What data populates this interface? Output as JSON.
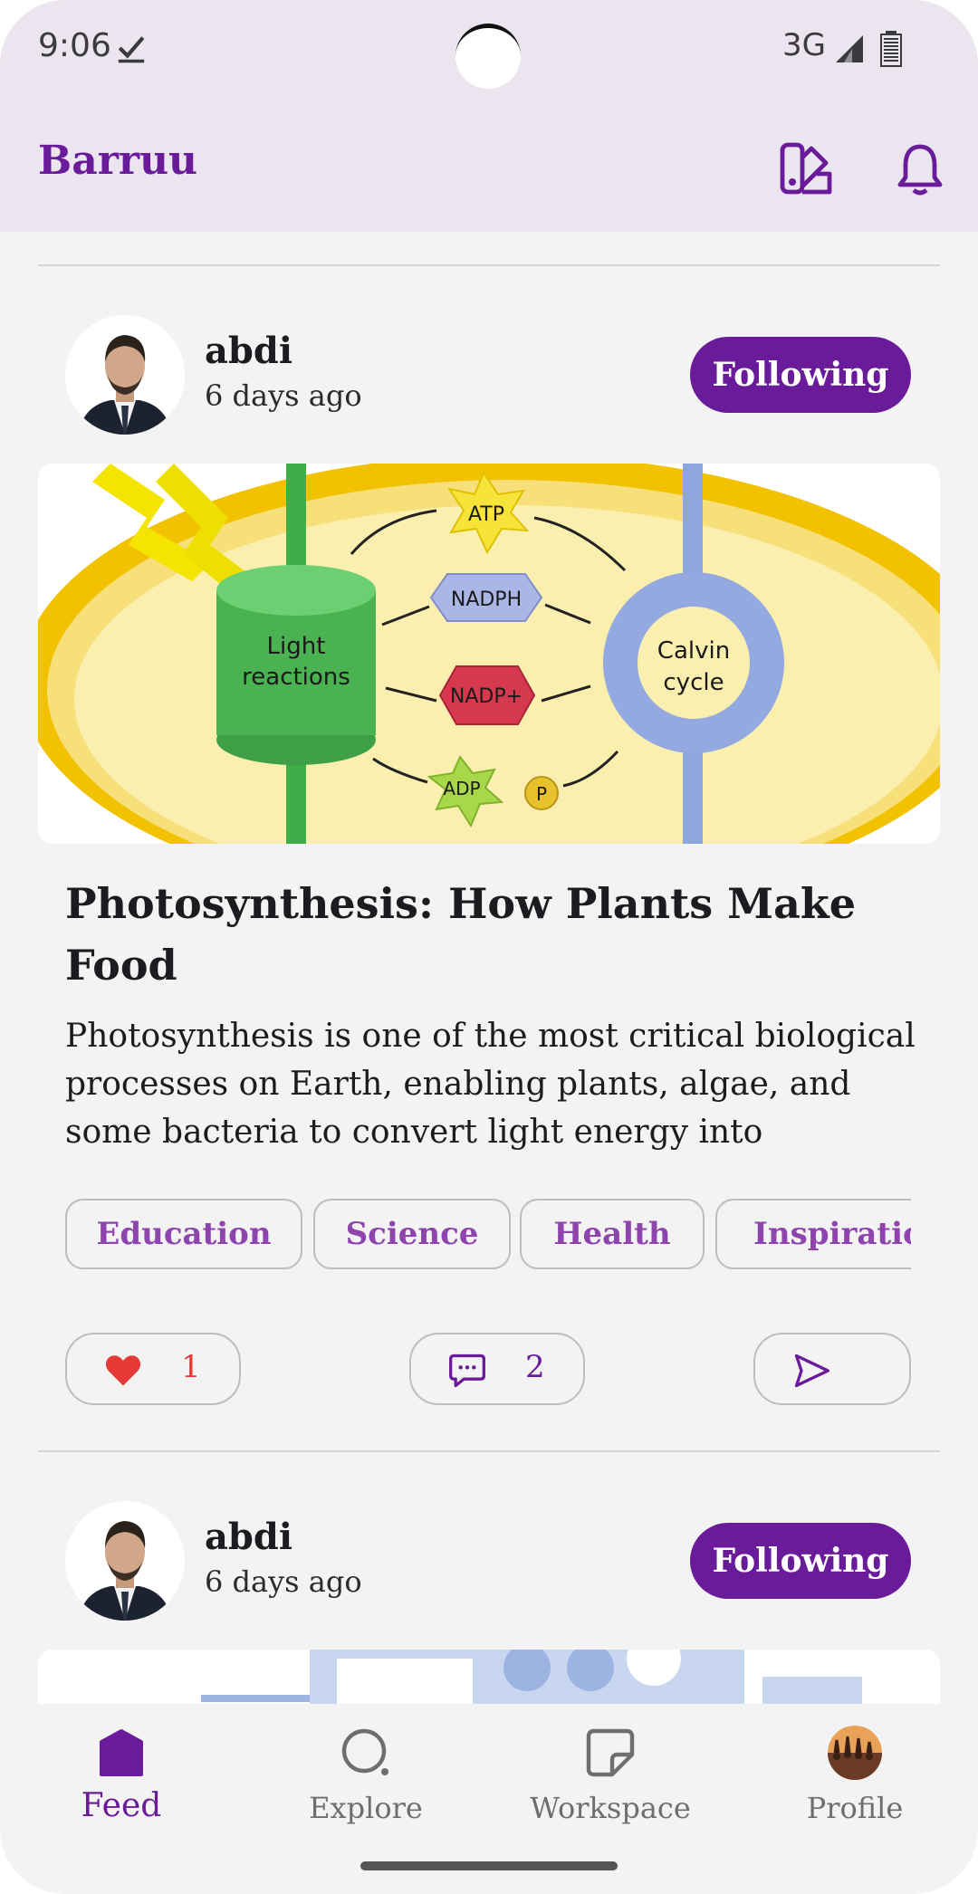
{
  "status_bar": {
    "time": "9:06",
    "network": "3G"
  },
  "app_bar": {
    "title": "Barruu"
  },
  "posts": [
    {
      "author": "abdi",
      "time": "6 days ago",
      "follow_label": "Following",
      "image_labels": {
        "atp": "ATP",
        "nadph": "NADPH",
        "nadp": "NADP+",
        "adp": "ADP",
        "p": "P",
        "light1": "Light",
        "light2": "reactions",
        "calvin1": "Calvin",
        "calvin2": "cycle"
      },
      "title": "Photosynthesis: How Plants Make Food",
      "excerpt": "Photosynthesis is one of the most critical biological processes on Earth, enabling plants, algae, and some bacteria to convert light energy into chemic…",
      "tags": [
        "Education",
        "Science",
        "Health",
        "Inspiration"
      ],
      "likes": "1",
      "comments": "2"
    },
    {
      "author": "abdi",
      "time": "6 days ago",
      "follow_label": "Following"
    }
  ],
  "nav": {
    "items": [
      {
        "label": "Feed",
        "icon": "home-icon",
        "active": true
      },
      {
        "label": "Explore",
        "icon": "search-icon",
        "active": false
      },
      {
        "label": "Workspace",
        "icon": "note-icon",
        "active": false
      },
      {
        "label": "Profile",
        "icon": "avatar",
        "active": false
      }
    ]
  },
  "colors": {
    "accent": "#6a1b9a",
    "like": "#e53935",
    "background": "#f3f3f3",
    "app_bar": "#ebe5ef"
  }
}
